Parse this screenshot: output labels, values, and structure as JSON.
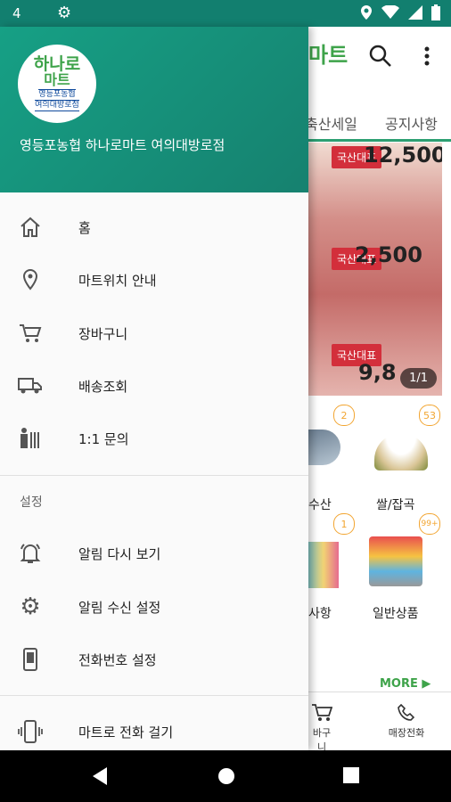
{
  "status_bar": {
    "time": "4"
  },
  "app": {
    "brand_partial": "마트",
    "tabs": [
      "축산세일",
      "공지사항"
    ],
    "banner": {
      "tag1": "국산대표",
      "price1": "12,500",
      "tag2": "국산대표",
      "price2": "2,500",
      "tag3": "국산대표",
      "price3": "9,8",
      "counter": "1/1"
    },
    "categories": [
      {
        "badge": "2",
        "label": "수산"
      },
      {
        "badge": "53",
        "label": "쌀/잡곡"
      },
      {
        "badge": "1",
        "label": "사항"
      },
      {
        "badge": "99+",
        "label": "일반상품"
      }
    ],
    "more": "MORE ▶",
    "bottom_nav": [
      "바구니",
      "매장전화"
    ]
  },
  "drawer": {
    "logo": {
      "line1": "하나로",
      "line2": "마트",
      "line3": "영등포농협",
      "line4": "여의대방로점"
    },
    "store_name": "영등포농협 하나로마트 여의대방로점",
    "items": [
      {
        "label": "홈",
        "icon": "home-icon"
      },
      {
        "label": "마트위치 안내",
        "icon": "location-pin-icon"
      },
      {
        "label": "장바구니",
        "icon": "cart-icon"
      },
      {
        "label": "배송조회",
        "icon": "truck-icon"
      },
      {
        "label": "1:1 문의",
        "icon": "people-icon"
      }
    ],
    "settings_title": "설정",
    "settings_items": [
      {
        "label": "알림 다시 보기",
        "icon": "bell-icon"
      },
      {
        "label": "알림 수신 설정",
        "icon": "gear-icon"
      },
      {
        "label": "전화번호 설정",
        "icon": "phone-icon"
      }
    ],
    "call_item": {
      "label": "마트로 전화 걸기",
      "icon": "ringing-phone-icon"
    }
  }
}
